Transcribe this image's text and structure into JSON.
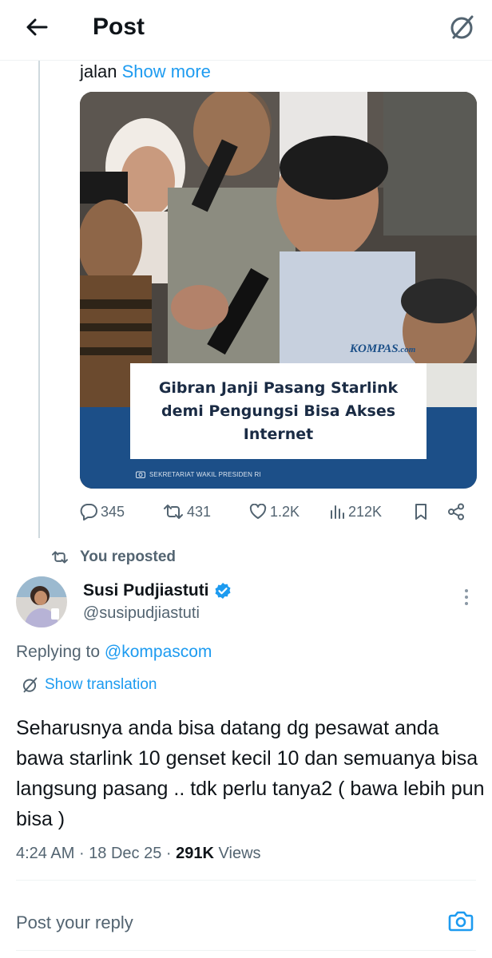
{
  "header": {
    "title": "Post",
    "back_icon": "arrow-left-icon",
    "translate_icon": "globe-translate-icon"
  },
  "quoted_post": {
    "text_tail": "jalan",
    "show_more_label": "Show more",
    "media": {
      "logo_text": "KOMPAS",
      "logo_suffix": ".com",
      "headline": "Gibran Janji Pasang Starlink demi Pengungsi Bisa Akses Internet",
      "credit": "SEKRETARIAT WAKIL PRESIDEN RI"
    },
    "actions": {
      "replies": "345",
      "reposts": "431",
      "likes": "1.2K",
      "views": "212K"
    }
  },
  "repost_label": "You reposted",
  "author": {
    "name": "Susi Pudjiastuti",
    "handle": "@susipudjiastuti",
    "verified": true
  },
  "replying": {
    "prefix": "Replying to",
    "mention": "@kompascom"
  },
  "show_translation_label": "Show translation",
  "body": "Seharusnya anda bisa datang dg pesawat anda bawa starlink 10 genset kecil 10 dan semuanya bisa langsung pasang .. tdk perlu tanya2 ( bawa lebih pun bisa )",
  "meta": {
    "time": "4:24 AM",
    "separator": "·",
    "date": "18 Dec 25",
    "views_count": "291K",
    "views_label": "Views"
  },
  "reply_box": {
    "placeholder": "Post your reply"
  },
  "colors": {
    "accent": "#1d9bf0",
    "secondary_text": "#536471",
    "headline_band": "#1c4f88"
  }
}
